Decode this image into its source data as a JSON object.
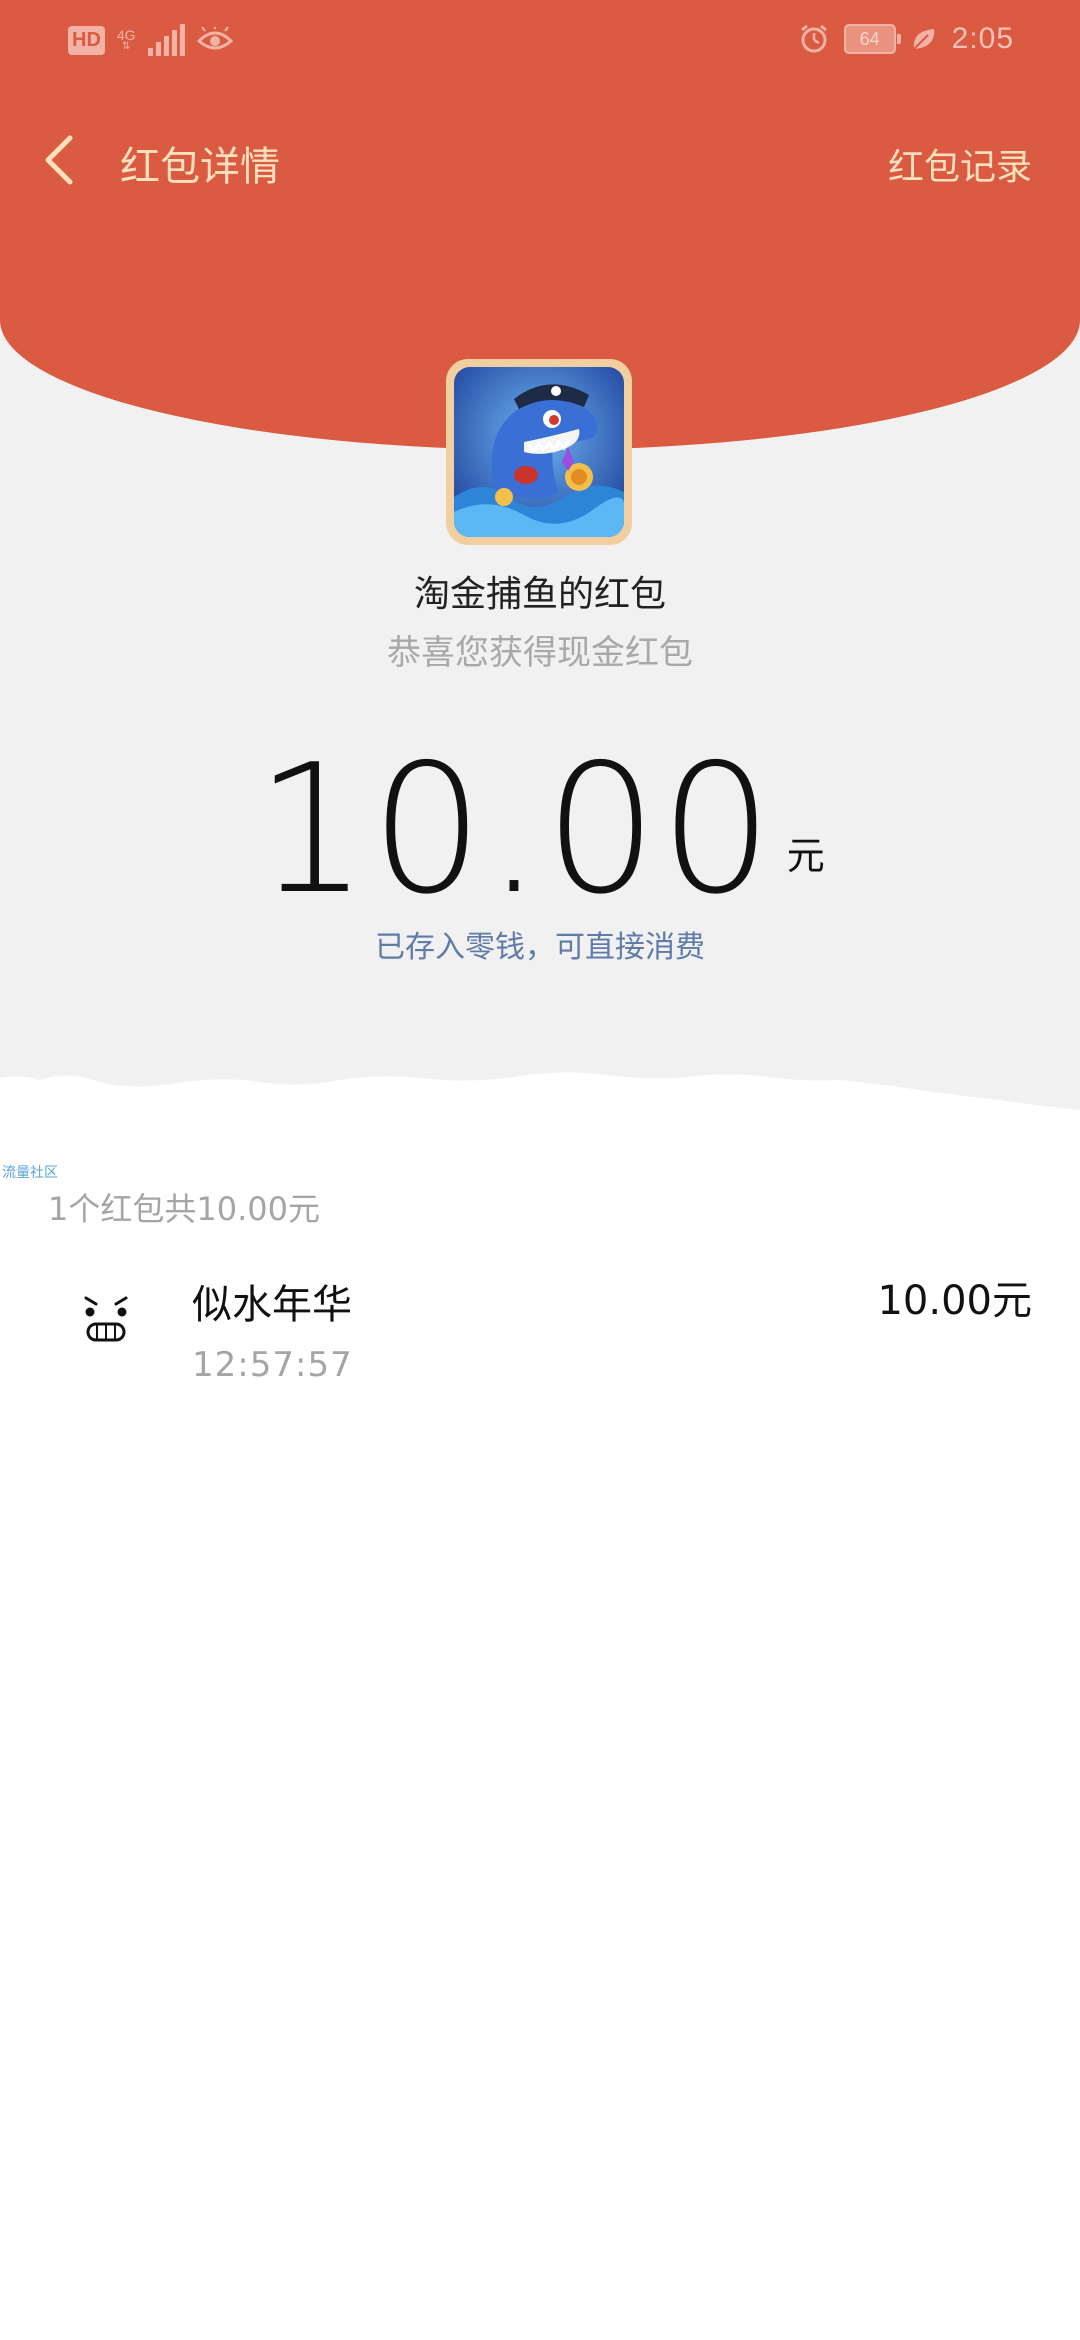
{
  "status_bar": {
    "hd": "HD",
    "network": "4G",
    "battery": "64",
    "time": "2:05"
  },
  "nav": {
    "title": "红包详情",
    "right_action": "红包记录"
  },
  "packet": {
    "sender_title": "淘金捕鱼的红包",
    "greeting": "恭喜您获得现金红包",
    "amount": "10.00",
    "unit": "元",
    "stored_note": "已存入零钱，可直接消费"
  },
  "watermark": "流量社区",
  "summary": "1个红包共10.00元",
  "receivers": [
    {
      "name": "似水年华",
      "time": "12:57:57",
      "amount": "10.00元"
    }
  ],
  "colors": {
    "header_red": "#db5a42",
    "header_text": "#fbe0bd",
    "link_blue": "#5f7ba8",
    "background_grey": "#f1f1f1"
  }
}
